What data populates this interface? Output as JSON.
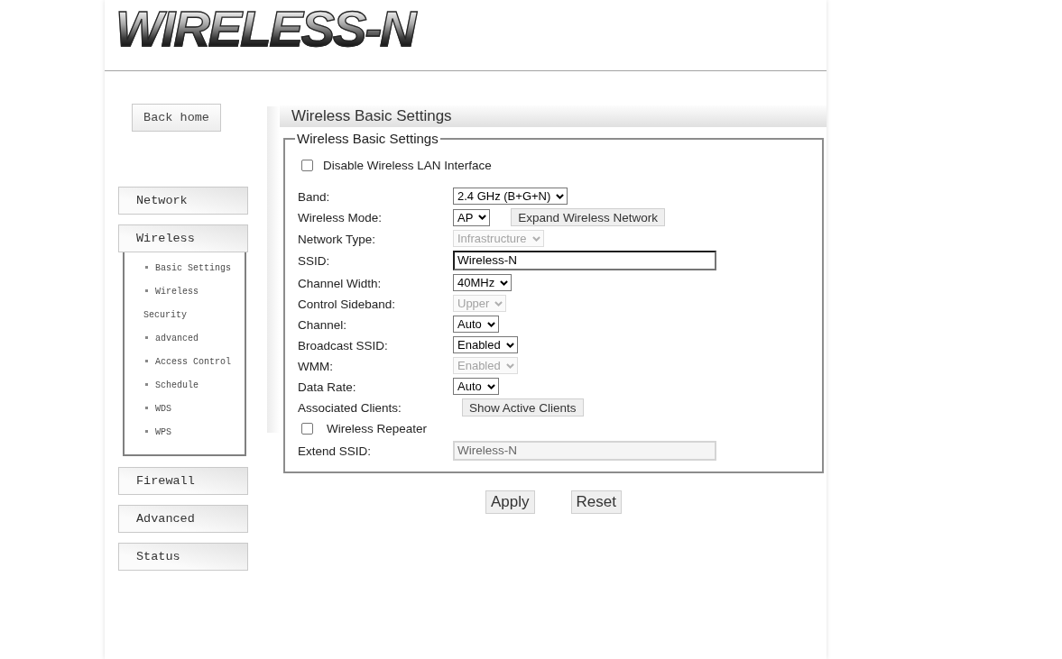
{
  "header": {
    "logo": "WIRELESS-N"
  },
  "sidebar": {
    "back_button": "Back home",
    "menu": [
      {
        "label": "Network",
        "expanded": false
      },
      {
        "label": "Wireless",
        "expanded": true,
        "children": [
          {
            "label": "Basic Settings"
          },
          {
            "label": "Wireless Security"
          },
          {
            "label": "advanced"
          },
          {
            "label": "Access Control"
          },
          {
            "label": "Schedule"
          },
          {
            "label": "WDS"
          },
          {
            "label": "WPS"
          }
        ]
      },
      {
        "label": "Firewall",
        "expanded": false
      },
      {
        "label": "Advanced",
        "expanded": false
      },
      {
        "label": "Status",
        "expanded": false
      }
    ]
  },
  "panel": {
    "title": "Wireless Basic Settings",
    "fieldset": {
      "legend": "Wireless Basic Settings",
      "disable_option": {
        "label": "Disable Wireless LAN Interface",
        "checked": false
      },
      "rows": [
        {
          "kind": "select",
          "label": "Band:",
          "value": "2.4 GHz (B+G+N)",
          "disabled": false
        },
        {
          "kind": "select",
          "label": "Wireless Mode:",
          "value": "AP",
          "disabled": false,
          "button": "Expand Wireless Network"
        },
        {
          "kind": "select",
          "label": "Network Type:",
          "value": "Infrastructure",
          "disabled": true
        },
        {
          "kind": "text",
          "label": "SSID:",
          "value": "Wireless-N",
          "disabled": false
        },
        {
          "kind": "select",
          "label": "Channel Width:",
          "value": "40MHz",
          "disabled": false
        },
        {
          "kind": "select",
          "label": "Control Sideband:",
          "value": "Upper",
          "disabled": true
        },
        {
          "kind": "select",
          "label": "Channel:",
          "value": "Auto",
          "disabled": false
        },
        {
          "kind": "select",
          "label": "Broadcast SSID:",
          "value": "Enabled",
          "disabled": false
        },
        {
          "kind": "select",
          "label": "WMM:",
          "value": "Enabled",
          "disabled": true
        },
        {
          "kind": "select",
          "label": "Data Rate:",
          "value": "Auto",
          "disabled": false
        },
        {
          "kind": "button",
          "label": "Associated Clients:",
          "button": "Show Active Clients",
          "disabled": false
        },
        {
          "kind": "checkbox",
          "label": "Wireless Repeater",
          "checked": false,
          "disabled": false
        },
        {
          "kind": "text",
          "label": "Extend SSID:",
          "value": "Wireless-N",
          "disabled": true
        }
      ]
    },
    "actions": [
      "Apply",
      "Reset"
    ]
  }
}
